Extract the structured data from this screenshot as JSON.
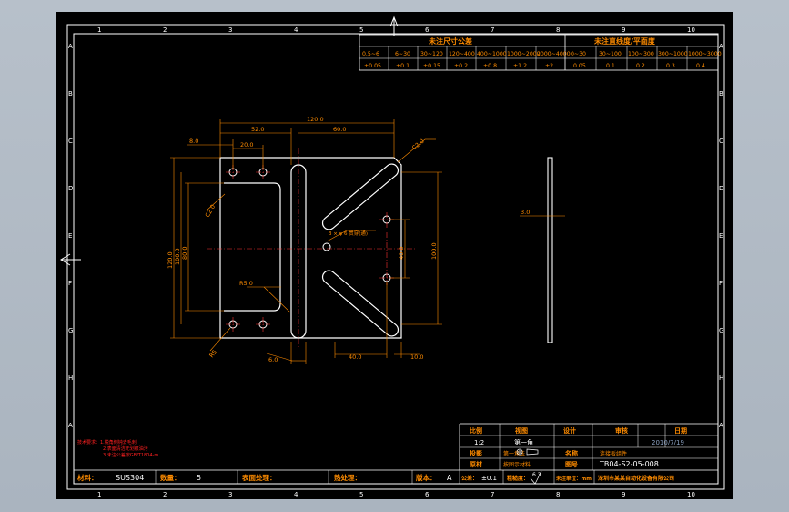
{
  "grid": {
    "cols_top": [
      "1",
      "2",
      "3",
      "4",
      "5",
      "6",
      "7",
      "8",
      "9",
      "10"
    ],
    "cols_bottom": [
      "1",
      "2",
      "3",
      "4",
      "5",
      "6",
      "7",
      "8",
      "9",
      "10"
    ],
    "rows": [
      "A",
      "B",
      "C",
      "D",
      "E",
      "F",
      "G",
      "H",
      "A"
    ]
  },
  "tolerance_table": {
    "title_left": "未注尺寸公差",
    "title_right": "未注直线度/平面度",
    "ranges_left": [
      "0.5~6",
      "6~30",
      "30~120",
      "120~400",
      "400~1000",
      "1000~2000",
      "2000~4000"
    ],
    "values_left": [
      "±0.05",
      "±0.1",
      "±0.15",
      "±0.2",
      "±0.8",
      "±1.2",
      "±2"
    ],
    "ranges_right": [
      "0~30",
      "30~100",
      "100~300",
      "300~1000",
      "1000~3000"
    ],
    "values_right": [
      "0.05",
      "0.1",
      "0.2",
      "0.3",
      "0.4"
    ]
  },
  "dimensions": {
    "d120": "120.0",
    "d52": "52.0",
    "d60": "60.0",
    "d8": "8.0",
    "d20": "20.0",
    "c20a": "C2.0",
    "c20b": "C2.0",
    "holes": "3 × φ 6 贯穿(通)",
    "d120v": "120.0",
    "d100v": "100.0",
    "d80v": "80.0",
    "d40": "40.0",
    "d100r": "100.0",
    "r50": "R5.0",
    "r5": "R5",
    "d6": "6.0",
    "d40b": "40.0",
    "d10": "10.0",
    "side_thk": "3.0"
  },
  "notes": {
    "line1": "技术要求：1.锐角倒钝去毛刺",
    "line2": "2.表面清洁无划痕油污",
    "line3": "3.未注公差按GB/T1804-m"
  },
  "title_block": {
    "scale_label": "比例",
    "scale_value": "1:2",
    "view_label": "视图",
    "view_value": "第一角",
    "designer_label": "设计",
    "reviewer_label": "审核",
    "date_label": "日期",
    "date_value": "2010/7/19",
    "projection_label": "投影",
    "projection_value": "第一角法",
    "name_label": "名称",
    "name_value": "连接板组件",
    "material_ref_label": "原材",
    "material_ref_value": "按图示材料",
    "drawing_no_label": "图号",
    "drawing_no_value": "TB04-S2-05-008",
    "material_label": "材料：",
    "material_value": "SUS304",
    "qty_label": "数量：",
    "qty_value": "5",
    "surface_label": "表面处理：",
    "heat_label": "热处理：",
    "version_label": "版本：",
    "version_value": "A",
    "tolerance_label": "公差：",
    "tolerance_value": "±0.1",
    "roughness_label": "粗糙度：",
    "roughness_value": "6.3",
    "unit_label": "未注单位：mm",
    "company_value": "深圳市某某自动化设备有限公司"
  },
  "colors": {
    "frame": "#ffffff",
    "contour": "#ffffff",
    "dimension": "#ff8c00",
    "centerline": "#ff3333",
    "table_text": "#ff8c00",
    "note": "#ff2020"
  }
}
